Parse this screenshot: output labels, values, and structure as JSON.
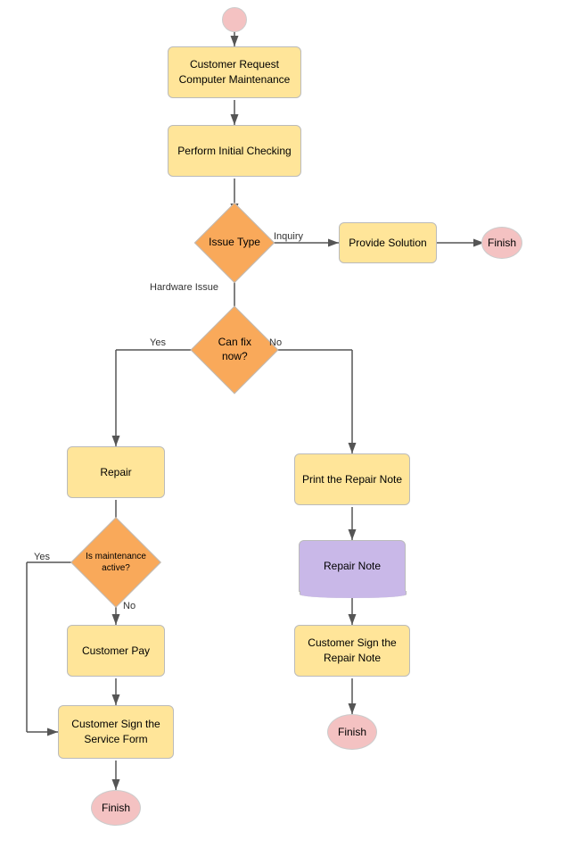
{
  "nodes": {
    "start": {
      "label": ""
    },
    "request": {
      "label": "Customer Request\nComputer Maintenance"
    },
    "initial_check": {
      "label": "Perform Initial Checking"
    },
    "issue_type": {
      "label": "Issue Type"
    },
    "provide_solution": {
      "label": "Provide Solution"
    },
    "finish1": {
      "label": "Finish"
    },
    "can_fix": {
      "label": "Can fix now?"
    },
    "repair": {
      "label": "Repair"
    },
    "print_note": {
      "label": "Print the Repair Note"
    },
    "repair_note_doc": {
      "label": "Repair Note"
    },
    "customer_sign_note": {
      "label": "Customer Sign the Repair Note"
    },
    "finish2": {
      "label": "Finish"
    },
    "is_maintenance": {
      "label": "Is\nmaintenance\nactive?"
    },
    "customer_pay": {
      "label": "Customer Pay"
    },
    "customer_sign_form": {
      "label": "Customer Sign the Service Form"
    },
    "finish3": {
      "label": "Finish"
    }
  },
  "edge_labels": {
    "inquiry": "Inquiry",
    "hardware": "Hardware Issue",
    "yes_fix": "Yes",
    "no_fix": "No",
    "yes_maint": "Yes",
    "no_maint": "No"
  }
}
